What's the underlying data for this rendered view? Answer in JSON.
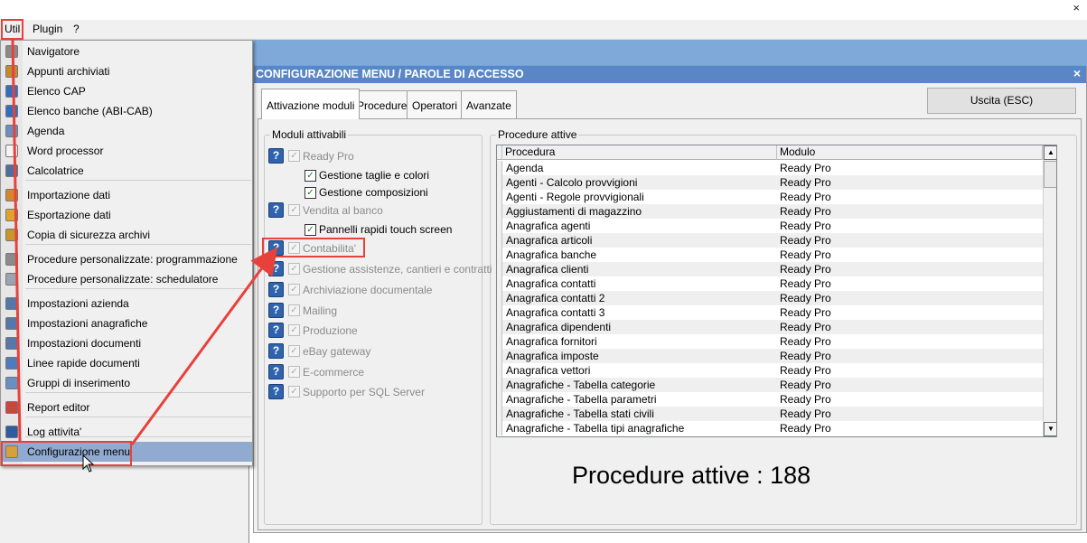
{
  "menubar": {
    "items": [
      "Util",
      "Plugin",
      "?"
    ]
  },
  "window": {
    "close_glyph": "×"
  },
  "dialog": {
    "title": "CONFIGURAZIONE MENU / PAROLE DI ACCESSO",
    "close_glyph": "×",
    "tabs": [
      "Attivazione moduli",
      "Procedure",
      "Operatori",
      "Avanzate"
    ],
    "exit_label": "Uscita (ESC)"
  },
  "modules": {
    "legend": "Moduli attivabili",
    "items": [
      "Ready Pro",
      "Vendita al banco",
      "Contabilita'",
      "Gestione assistenze, cantieri e contratti",
      "Archiviazione documentale",
      "Mailing",
      "Produzione",
      "eBay gateway",
      "E-commerce",
      "Supporto per SQL Server"
    ],
    "subitems": [
      "Gestione taglie e colori",
      "Gestione composizioni",
      "Pannelli rapidi touch screen"
    ]
  },
  "procedures": {
    "legend": "Procedure attive",
    "columns": [
      "Procedura",
      "Modulo"
    ],
    "rows": [
      [
        "Agenda",
        "Ready Pro"
      ],
      [
        "Agenti - Calcolo provvigioni",
        "Ready Pro"
      ],
      [
        "Agenti - Regole provvigionali",
        "Ready Pro"
      ],
      [
        "Aggiustamenti di magazzino",
        "Ready Pro"
      ],
      [
        "Anagrafica agenti",
        "Ready Pro"
      ],
      [
        "Anagrafica articoli",
        "Ready Pro"
      ],
      [
        "Anagrafica banche",
        "Ready Pro"
      ],
      [
        "Anagrafica clienti",
        "Ready Pro"
      ],
      [
        "Anagrafica contatti",
        "Ready Pro"
      ],
      [
        "Anagrafica contatti 2",
        "Ready Pro"
      ],
      [
        "Anagrafica contatti 3",
        "Ready Pro"
      ],
      [
        "Anagrafica dipendenti",
        "Ready Pro"
      ],
      [
        "Anagrafica fornitori",
        "Ready Pro"
      ],
      [
        "Anagrafica imposte",
        "Ready Pro"
      ],
      [
        "Anagrafica vettori",
        "Ready Pro"
      ],
      [
        "Anagrafiche - Tabella categorie",
        "Ready Pro"
      ],
      [
        "Anagrafiche - Tabella parametri",
        "Ready Pro"
      ],
      [
        "Anagrafiche - Tabella stati civili",
        "Ready Pro"
      ],
      [
        "Anagrafiche - Tabella tipi anagrafiche",
        "Ready Pro"
      ]
    ],
    "count_label": "Procedure attive : 188"
  },
  "util_menu": {
    "items": [
      "Navigatore",
      "Appunti archiviati",
      "Elenco CAP",
      "Elenco banche (ABI-CAB)",
      "Agenda",
      "Word processor",
      "Calcolatrice",
      "Importazione dati",
      "Esportazione dati",
      "Copia di sicurezza archivi",
      "Procedure personalizzate: programmazione",
      "Procedure personalizzate: schedulatore",
      "Impostazioni azienda",
      "Impostazioni anagrafiche",
      "Impostazioni documenti",
      "Linee rapide documenti",
      "Gruppi di inserimento",
      "Report editor",
      "Log attivita'",
      "Configurazione menu"
    ],
    "icons": [
      "compass-icon",
      "notes-icon",
      "search-icon",
      "search-icon",
      "calendar-icon",
      "document-icon",
      "calculator-icon",
      "import-icon",
      "export-icon",
      "backup-icon",
      "gears-icon",
      "clock-icon",
      "form-icon",
      "form-icon",
      "form-icon",
      "network-icon",
      "grid-icon",
      "report-icon",
      "book-icon",
      "lock-icon"
    ],
    "selected_index": 19
  },
  "colors": {
    "highlight": "#e8413c",
    "title_blue": "#5b86c5",
    "help_blue": "#2f63ad",
    "selection": "#91abd0"
  }
}
